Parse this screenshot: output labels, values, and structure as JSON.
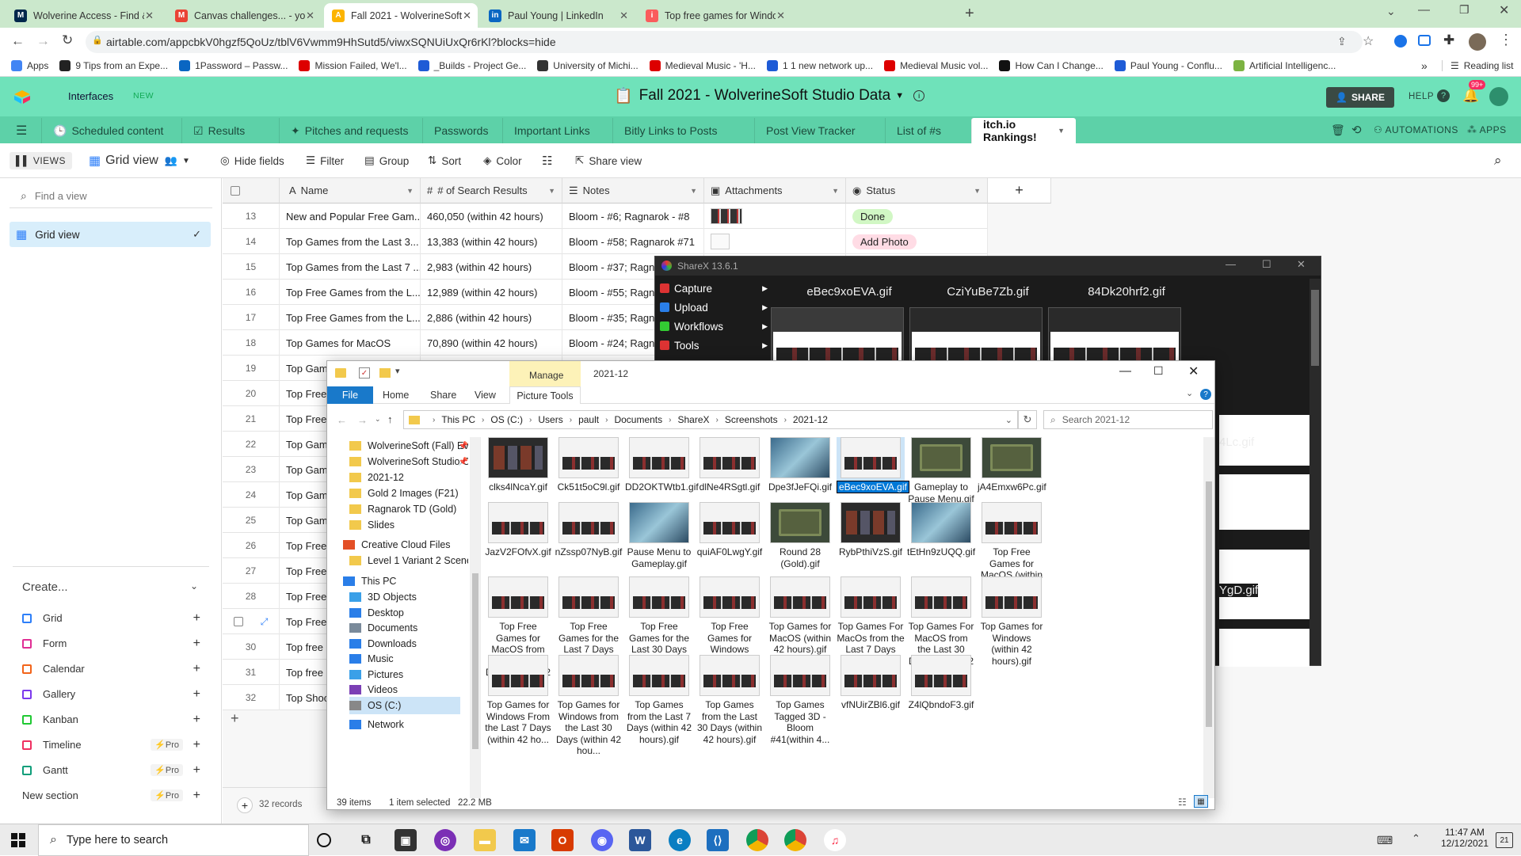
{
  "browser": {
    "tabs": [
      {
        "title": "Wolverine Access - Find & Favori",
        "icon": "M"
      },
      {
        "title": "Canvas challenges... - youngpaul",
        "icon": "M"
      },
      {
        "title": "Fall 2021 - WolverineSoft Studio",
        "icon": "A"
      },
      {
        "title": "Paul Young | LinkedIn",
        "icon": "in"
      },
      {
        "title": "Top free games for Windows fro",
        "icon": "i"
      }
    ],
    "url": "airtable.com/appcbkV0hgzf5QoUz/tblV6Vwmm9HhSutd5/viwxSQNUiUxQr6rKl?blocks=hide",
    "bookmarks": [
      "Apps",
      "9 Tips from an Expe...",
      "1Password – Passw...",
      "Mission Failed, We'l...",
      "_Builds - Project Ge...",
      "University of Michi...",
      "Medieval Music - 'H...",
      "1 1 new network up...",
      "Medieval Music vol...",
      "How Can I Change...",
      "Paul Young - Conflu...",
      "Artificial Intelligenc..."
    ],
    "bookmarks_more": "»",
    "reading_list": "Reading list"
  },
  "airtable": {
    "interfaces": "Interfaces",
    "new_badge": "NEW",
    "base_title": "Fall 2021 - WolverineSoft Studio Data",
    "share": "SHARE",
    "help": "HELP",
    "notif_badge": "99+",
    "tables": [
      "Scheduled content",
      "Results",
      "Pitches and requests",
      "Passwords",
      "Important Links",
      "Bitly Links to Posts",
      "Post View Tracker",
      "List of #s",
      "itch.io Rankings!"
    ],
    "automations": "AUTOMATIONS",
    "apps": "APPS",
    "toolbar": {
      "views": "VIEWS",
      "grid_view": "Grid view",
      "hide_fields": "Hide fields",
      "filter": "Filter",
      "group": "Group",
      "sort": "Sort",
      "color": "Color",
      "share_view": "Share view"
    },
    "sidebar": {
      "find_placeholder": "Find a view",
      "active_view": "Grid view",
      "create": "Create...",
      "create_items": [
        {
          "label": "Grid",
          "color": "#2d7ff9",
          "pro": ""
        },
        {
          "label": "Form",
          "color": "#e02e94",
          "pro": ""
        },
        {
          "label": "Calendar",
          "color": "#f2641a",
          "pro": ""
        },
        {
          "label": "Gallery",
          "color": "#7c39ed",
          "pro": ""
        },
        {
          "label": "Kanban",
          "color": "#20c933",
          "pro": ""
        },
        {
          "label": "Timeline",
          "color": "#ef3061",
          "pro": "Pro"
        },
        {
          "label": "Gantt",
          "color": "#0f9e7a",
          "pro": "Pro"
        },
        {
          "label": "New section",
          "color": "",
          "pro": "Pro"
        }
      ]
    },
    "columns": [
      "Name",
      "# of Search Results",
      "Notes",
      "Attachments",
      "Status"
    ],
    "rows": [
      {
        "n": "13",
        "name": "New and Popular Free Gam...",
        "results": "460,050 (within 42 hours)",
        "notes": "Bloom - #6; Ragnarok - #8",
        "status": "Done"
      },
      {
        "n": "14",
        "name": "Top Games from the Last 3...",
        "results": "13,383 (within 42 hours)",
        "notes": "Bloom - #58; Ragnarok #71",
        "status": "Add Photo"
      },
      {
        "n": "15",
        "name": "Top Games from the Last 7 ...",
        "results": "2,983 (within 42 hours)",
        "notes": "Bloom - #37; Ragn",
        "status": ""
      },
      {
        "n": "16",
        "name": "Top Free Games from the L...",
        "results": "12,989 (within 42 hours)",
        "notes": "Bloom - #55; Ragn",
        "status": ""
      },
      {
        "n": "17",
        "name": "Top Free Games from the L...",
        "results": "2,886 (within 42 hours)",
        "notes": "Bloom - #35; Ragn",
        "status": ""
      },
      {
        "n": "18",
        "name": "Top Games for MacOS",
        "results": "70,890 (within 42 hours)",
        "notes": "Bloom - #24; Ragn",
        "status": ""
      },
      {
        "n": "19",
        "name": "Top Game",
        "results": "",
        "notes": "",
        "status": ""
      },
      {
        "n": "20",
        "name": "Top Free C",
        "results": "",
        "notes": "",
        "status": ""
      },
      {
        "n": "21",
        "name": "Top Free C",
        "results": "",
        "notes": "",
        "status": ""
      },
      {
        "n": "22",
        "name": "Top Game",
        "results": "",
        "notes": "",
        "status": ""
      },
      {
        "n": "23",
        "name": "Top Game",
        "results": "",
        "notes": "",
        "status": ""
      },
      {
        "n": "24",
        "name": "Top Game",
        "results": "",
        "notes": "",
        "status": ""
      },
      {
        "n": "25",
        "name": "Top Game",
        "results": "",
        "notes": "",
        "status": ""
      },
      {
        "n": "26",
        "name": "Top Free C",
        "results": "",
        "notes": "",
        "status": ""
      },
      {
        "n": "27",
        "name": "Top Free C",
        "results": "",
        "notes": "",
        "status": ""
      },
      {
        "n": "28",
        "name": "Top Free C",
        "results": "",
        "notes": "",
        "status": ""
      },
      {
        "n": "",
        "name": "Top Free C",
        "results": "",
        "notes": "",
        "status": ""
      },
      {
        "n": "30",
        "name": "Top free S",
        "results": "",
        "notes": "",
        "status": ""
      },
      {
        "n": "31",
        "name": "Top free S",
        "results": "",
        "notes": "",
        "status": ""
      },
      {
        "n": "32",
        "name": "Top Shoot",
        "results": "",
        "notes": "",
        "status": ""
      }
    ],
    "records": "32 records"
  },
  "sharex": {
    "title": "ShareX 13.6.1",
    "menu": [
      "Capture",
      "Upload",
      "Workflows",
      "Tools"
    ],
    "thumbs": [
      "eBec9xoEVA.gif",
      "CziYuBe7Zb.gif",
      "84Dk20hrf2.gif"
    ],
    "partial_labels": [
      "4Lc.gif",
      "YgD.gif"
    ]
  },
  "explorer": {
    "manage": "Manage",
    "folder": "2021-12",
    "ribbon": [
      "File",
      "Home",
      "Share",
      "View",
      "Picture Tools"
    ],
    "breadcrumb": [
      "This PC",
      "OS (C:)",
      "Users",
      "pault",
      "Documents",
      "ShareX",
      "Screenshots",
      "2021-12"
    ],
    "search_placeholder": "Search 2021-12",
    "nav": [
      "WolverineSoft (Fall) Evi",
      "WolverineSoft Studio C",
      "2021-12",
      "Gold 2 Images (F21)",
      "Ragnarok TD (Gold)",
      "Slides",
      "Creative Cloud Files",
      "Level 1 Variant 2 Scene-as",
      "This PC",
      "3D Objects",
      "Desktop",
      "Documents",
      "Downloads",
      "Music",
      "Pictures",
      "Videos",
      "OS (C:)",
      "Network"
    ],
    "files": [
      {
        "name": "clks4lNcaY.gif",
        "kind": "dark"
      },
      {
        "name": "Ck51t5oC9l.gif",
        "kind": "web"
      },
      {
        "name": "DD2OKTWtb1.gif",
        "kind": "web"
      },
      {
        "name": "dlNe4RSgtl.gif",
        "kind": "web"
      },
      {
        "name": "Dpe3fJeFQi.gif",
        "kind": "art"
      },
      {
        "name": "eBec9xoEVA.gif",
        "kind": "web",
        "sel": true
      },
      {
        "name": "Gameplay to Pause Menu.gif",
        "kind": "game"
      },
      {
        "name": "jA4Emxw6Pc.gif",
        "kind": "game"
      },
      {
        "name": "JazV2FOfvX.gif",
        "kind": "web"
      },
      {
        "name": "nZssp07NyB.gif",
        "kind": "web"
      },
      {
        "name": "Pause Menu to Gameplay.gif",
        "kind": "art"
      },
      {
        "name": "quiAF0LwgY.gif",
        "kind": "web"
      },
      {
        "name": "Round 28 (Gold).gif",
        "kind": "game"
      },
      {
        "name": "RybPthiVzS.gif",
        "kind": "dark"
      },
      {
        "name": "tEtHn9zUQQ.gif",
        "kind": "art"
      },
      {
        "name": "Top Free Games for MacOS (within 42 hours).gif",
        "kind": "web"
      },
      {
        "name": "Top Free Games for MacOS from the Last 30 Days (within 42 hou...",
        "kind": "web"
      },
      {
        "name": "Top Free Games for the Last 7 Days (within 42 hours).gif",
        "kind": "web"
      },
      {
        "name": "Top Free Games for the Last 30 Days (within 42 hours).gif",
        "kind": "web"
      },
      {
        "name": "Top Free Games for Windows (within 42 hours).gif",
        "kind": "web"
      },
      {
        "name": "Top Games for MacOS (within 42 hours).gif",
        "kind": "web"
      },
      {
        "name": "Top Games For MacOs from the Last 7 Days (within 42 hour...",
        "kind": "web"
      },
      {
        "name": "Top Games For MacOS from the Last 30 Days (within 42 hour...",
        "kind": "web"
      },
      {
        "name": "Top Games for Windows (within 42 hours).gif",
        "kind": "web"
      },
      {
        "name": "Top Games for Windows From the Last 7 Days (within 42 ho...",
        "kind": "web"
      },
      {
        "name": "Top Games for Windows from the Last 30 Days (within 42 hou...",
        "kind": "web"
      },
      {
        "name": "Top Games from the Last 7 Days (within 42 hours).gif",
        "kind": "web"
      },
      {
        "name": "Top Games from the Last 30 Days (within 42 hours).gif",
        "kind": "web"
      },
      {
        "name": "Top Games Tagged 3D - Bloom #41(within 4...",
        "kind": "web"
      },
      {
        "name": "vfNUirZBl6.gif",
        "kind": "web"
      },
      {
        "name": "Z4lQbndoF3.gif",
        "kind": "web"
      }
    ],
    "status": {
      "count": "39 items",
      "selected": "1 item selected",
      "size": "22.2 MB"
    }
  },
  "taskbar": {
    "search": "Type here to search",
    "time": "11:47 AM",
    "date": "12/12/2021",
    "notif": "21"
  }
}
